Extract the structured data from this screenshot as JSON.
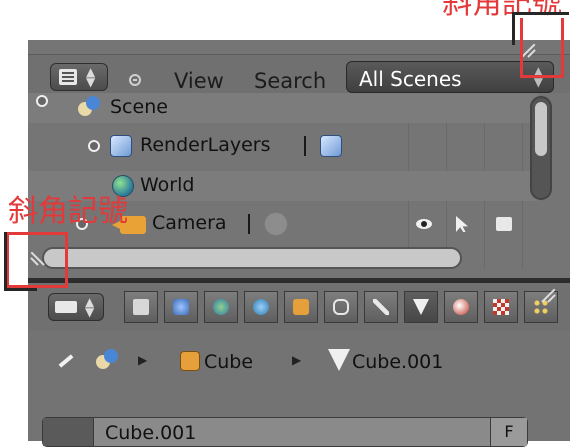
{
  "annotations": {
    "corner_label_bottom": "斜角記號"
  },
  "outliner": {
    "menu": {
      "view": "View",
      "search": "Search"
    },
    "scenes_dropdown": {
      "value": "All Scenes"
    },
    "rows": [
      {
        "label": "Scene"
      },
      {
        "label": "RenderLayers"
      },
      {
        "label": "World"
      },
      {
        "label": "Camera"
      }
    ]
  },
  "properties": {
    "context_tabs": [
      "render",
      "render-layers",
      "scene",
      "world",
      "object",
      "constraints",
      "modifiers",
      "mesh-data",
      "material",
      "texture",
      "particles"
    ],
    "active_tab": "mesh-data",
    "breadcrumb": {
      "object": "Cube",
      "mesh": "Cube.001"
    },
    "mesh_field": {
      "name": "Cube.001",
      "fake_user_label": "F"
    }
  },
  "colors": {
    "annotation_red": "#e23a3a",
    "selected_row": "#8e9aa6",
    "panel_bg": "#757575"
  }
}
